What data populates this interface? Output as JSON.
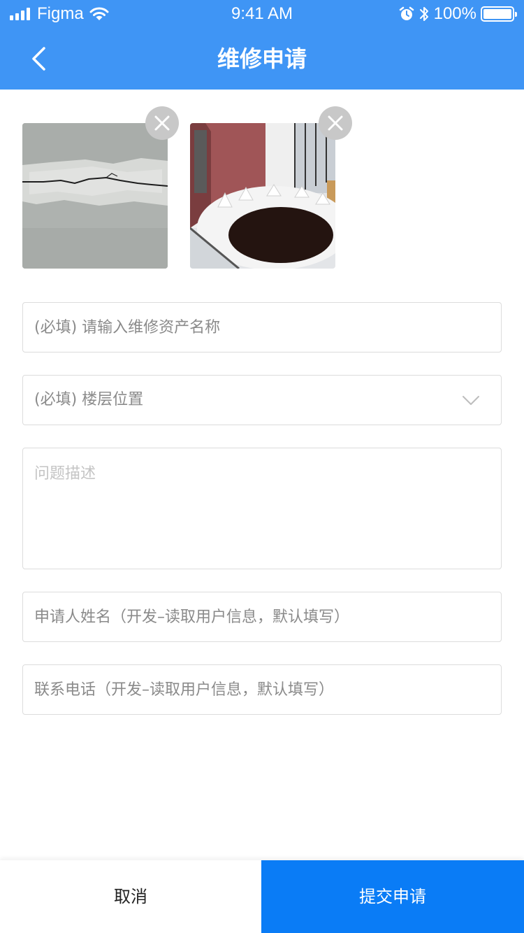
{
  "status_bar": {
    "carrier": "Figma",
    "time": "9:41 AM",
    "battery": "100%"
  },
  "nav": {
    "title": "维修申请"
  },
  "photos": [
    {
      "icon": "wall-crack-photo"
    },
    {
      "icon": "room-interior-photo"
    }
  ],
  "form": {
    "asset_name_placeholder": "(必填) 请输入维修资产名称",
    "floor_placeholder": "(必填) 楼层位置",
    "description_placeholder": "问题描述",
    "applicant_placeholder": "申请人姓名（开发–读取用户信息，默认填写）",
    "phone_placeholder": "联系电话（开发–读取用户信息，默认填写）"
  },
  "actions": {
    "cancel_label": "取消",
    "submit_label": "提交申请"
  },
  "colors": {
    "header": "#3f95f5",
    "submit": "#0a7cf6",
    "border": "#dcdcdc"
  }
}
